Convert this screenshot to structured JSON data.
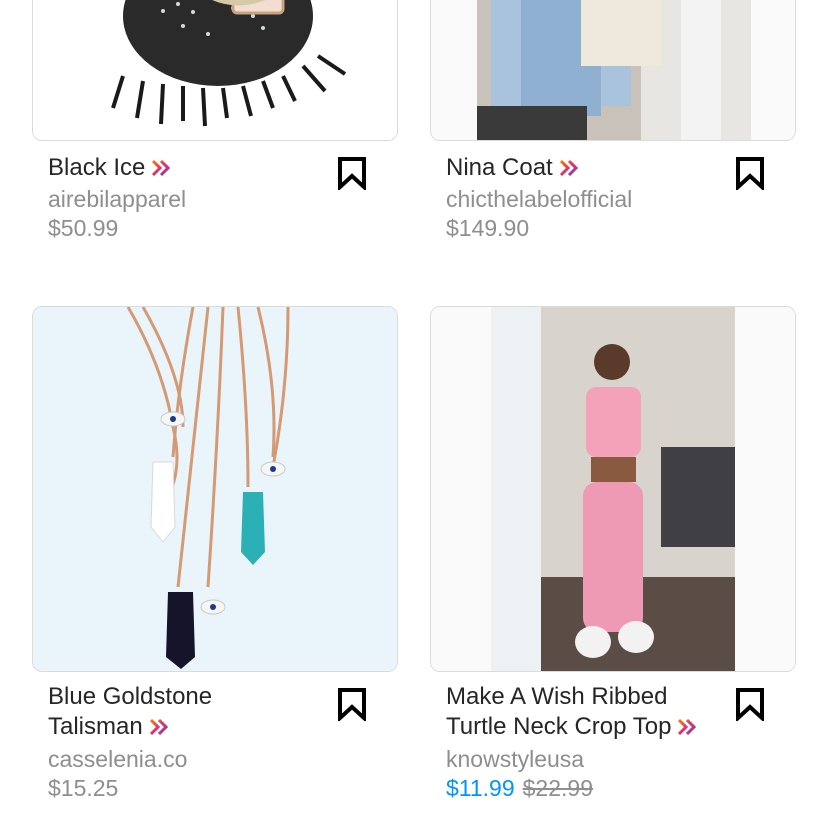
{
  "products": [
    {
      "title": "Black Ice",
      "seller": "airebilapparel",
      "price": "$50.99"
    },
    {
      "title": "Nina Coat",
      "seller": "chicthelabelofficial",
      "price": "$149.90"
    },
    {
      "title_line1": "Blue Goldstone",
      "title_line2": "Talisman",
      "seller": "casselenia.co",
      "price": "$15.25"
    },
    {
      "title_line1": "Make A Wish Ribbed",
      "title_line2": "Turtle Neck Crop Top",
      "seller": "knowstyleusa",
      "sale_price": "$11.99",
      "original_price": "$22.99"
    }
  ],
  "icons": {
    "checkout": "instagram-checkout-chevron-icon",
    "save": "bookmark-icon"
  },
  "colors": {
    "sale": "#0095f6",
    "muted": "#8e8e8e",
    "text": "#262626"
  }
}
